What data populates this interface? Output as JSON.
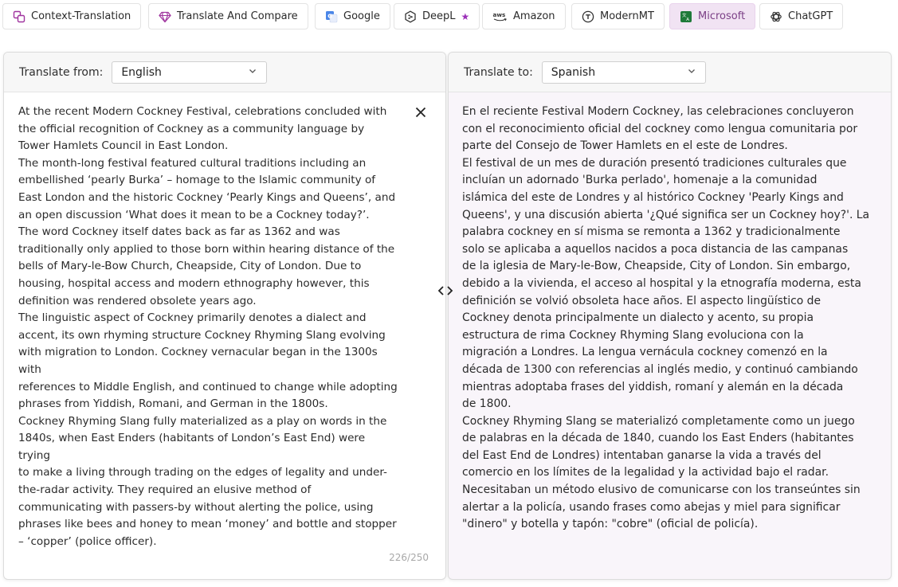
{
  "tabs": [
    {
      "label": "Context-Translation",
      "icon": "context-translation-icon",
      "active": false
    },
    {
      "label": "Translate And Compare",
      "icon": "gem-icon",
      "active": false
    },
    {
      "label": "Google",
      "icon": "google-translate-icon",
      "active": false
    },
    {
      "label": "DeepL",
      "icon": "deepl-icon",
      "active": false,
      "badge": "★"
    },
    {
      "label": "Amazon",
      "icon": "aws-icon",
      "active": false
    },
    {
      "label": "ModernMT",
      "icon": "modernmt-icon",
      "active": false
    },
    {
      "label": "Microsoft",
      "icon": "microsoft-translator-icon",
      "active": true
    },
    {
      "label": "ChatGPT",
      "icon": "chatgpt-icon",
      "active": false
    }
  ],
  "source": {
    "label": "Translate from:",
    "language": "English",
    "text": "At the recent Modern Cockney Festival, celebrations concluded with\nthe official recognition of Cockney as a community language by\nTower Hamlets Council in East London.\nThe month-long festival featured cultural traditions including an\nembellished ‘pearly Burka’ – homage to the Islamic community of\nEast London and the historic Cockney ‘Pearly Kings and Queens’, and\nan open discussion ‘What does it mean to be a Cockney today?’.\nThe word Cockney itself dates back as far as 1362 and was\ntraditionally only applied to those born within hearing distance of the\nbells of Mary-le-Bow Church, Cheapside, City of London. Due to\nhousing, hospital access and modern ethnography however, this\ndefinition was rendered obsolete years ago.\nThe linguistic aspect of Cockney primarily denotes a dialect and\naccent, its own rhyming structure Cockney Rhyming Slang evolving\nwith migration to London. Cockney vernacular began in the 1300s with\nreferences to Middle English, and continued to change while adopting\nphrases from Yiddish, Romani, and German in the 1800s.\nCockney Rhyming Slang fully materialized as a play on words in the\n1840s, when East Enders (habitants of London’s East End) were trying\nto make a living through trading on the edges of legality and under-\nthe-radar activity. They required an elusive method of\ncommunicating with passers-by without alerting the police, using\nphrases like bees and honey to mean ‘money’ and bottle and stopper\n– ‘copper’ (police officer).",
    "counter": "226/250"
  },
  "target": {
    "label": "Translate to:",
    "language": "Spanish",
    "text": "En el reciente Festival Modern Cockney, las celebraciones concluyeron\ncon el reconocimiento oficial del cockney como lengua comunitaria por\nparte del Consejo de Tower Hamlets en el este de Londres.\nEl festival de un mes de duración presentó tradiciones culturales que\nincluían un adornado 'Burka perlado', homenaje a la comunidad\nislámica del este de Londres y al histórico Cockney 'Pearly Kings and\nQueens', y una discusión abierta '¿Qué significa ser un Cockney hoy?'. La\npalabra cockney en sí misma se remonta a 1362 y tradicionalmente\nsolo se aplicaba a aquellos nacidos a poca distancia de las campanas\nde la iglesia de Mary-le-Bow, Cheapside, City of London. Sin embargo,\ndebido a la vivienda, el acceso al hospital y la etnografía moderna, esta\ndefinición se volvió obsoleta hace años. El aspecto lingüístico de\nCockney denota principalmente un dialecto y acento, su propia\nestructura de rima Cockney Rhyming Slang evoluciona con la\nmigración a Londres. La lengua vernácula cockney comenzó en la\ndécada de 1300 con referencias al inglés medio, y continuó cambiando\nmientras adoptaba frases del yiddish, romaní y alemán en la década\nde 1800.\nCockney Rhyming Slang se materializó completamente como un juego\nde palabras en la década de 1840, cuando los East Enders (habitantes\ndel East End de Londres) intentaban ganarse la vida a través del\ncomercio en los límites de la legalidad y la actividad bajo el radar.\nNecesitaban un método elusivo de comunicarse con los transeúntes sin\nalertar a la policía, usando frases como abejas y miel para significar\n\"dinero\" y botella y tapón: \"cobre\" (oficial de policía)."
  },
  "colors": {
    "active_tab_bg": "#f1e3f3",
    "active_tab_text": "#7b3f86",
    "deepl_star": "#9b2fb8",
    "target_panel_bg": "#f9f5fa"
  }
}
